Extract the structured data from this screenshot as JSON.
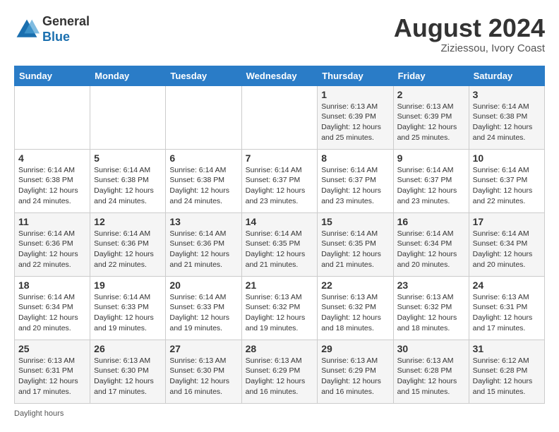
{
  "header": {
    "logo_general": "General",
    "logo_blue": "Blue",
    "title": "August 2024",
    "location": "Ziziessou, Ivory Coast"
  },
  "weekdays": [
    "Sunday",
    "Monday",
    "Tuesday",
    "Wednesday",
    "Thursday",
    "Friday",
    "Saturday"
  ],
  "weeks": [
    [
      {
        "day": "",
        "info": ""
      },
      {
        "day": "",
        "info": ""
      },
      {
        "day": "",
        "info": ""
      },
      {
        "day": "",
        "info": ""
      },
      {
        "day": "1",
        "info": "Sunrise: 6:13 AM\nSunset: 6:39 PM\nDaylight: 12 hours\nand 25 minutes."
      },
      {
        "day": "2",
        "info": "Sunrise: 6:13 AM\nSunset: 6:39 PM\nDaylight: 12 hours\nand 25 minutes."
      },
      {
        "day": "3",
        "info": "Sunrise: 6:14 AM\nSunset: 6:38 PM\nDaylight: 12 hours\nand 24 minutes."
      }
    ],
    [
      {
        "day": "4",
        "info": "Sunrise: 6:14 AM\nSunset: 6:38 PM\nDaylight: 12 hours\nand 24 minutes."
      },
      {
        "day": "5",
        "info": "Sunrise: 6:14 AM\nSunset: 6:38 PM\nDaylight: 12 hours\nand 24 minutes."
      },
      {
        "day": "6",
        "info": "Sunrise: 6:14 AM\nSunset: 6:38 PM\nDaylight: 12 hours\nand 24 minutes."
      },
      {
        "day": "7",
        "info": "Sunrise: 6:14 AM\nSunset: 6:37 PM\nDaylight: 12 hours\nand 23 minutes."
      },
      {
        "day": "8",
        "info": "Sunrise: 6:14 AM\nSunset: 6:37 PM\nDaylight: 12 hours\nand 23 minutes."
      },
      {
        "day": "9",
        "info": "Sunrise: 6:14 AM\nSunset: 6:37 PM\nDaylight: 12 hours\nand 23 minutes."
      },
      {
        "day": "10",
        "info": "Sunrise: 6:14 AM\nSunset: 6:37 PM\nDaylight: 12 hours\nand 22 minutes."
      }
    ],
    [
      {
        "day": "11",
        "info": "Sunrise: 6:14 AM\nSunset: 6:36 PM\nDaylight: 12 hours\nand 22 minutes."
      },
      {
        "day": "12",
        "info": "Sunrise: 6:14 AM\nSunset: 6:36 PM\nDaylight: 12 hours\nand 22 minutes."
      },
      {
        "day": "13",
        "info": "Sunrise: 6:14 AM\nSunset: 6:36 PM\nDaylight: 12 hours\nand 21 minutes."
      },
      {
        "day": "14",
        "info": "Sunrise: 6:14 AM\nSunset: 6:35 PM\nDaylight: 12 hours\nand 21 minutes."
      },
      {
        "day": "15",
        "info": "Sunrise: 6:14 AM\nSunset: 6:35 PM\nDaylight: 12 hours\nand 21 minutes."
      },
      {
        "day": "16",
        "info": "Sunrise: 6:14 AM\nSunset: 6:34 PM\nDaylight: 12 hours\nand 20 minutes."
      },
      {
        "day": "17",
        "info": "Sunrise: 6:14 AM\nSunset: 6:34 PM\nDaylight: 12 hours\nand 20 minutes."
      }
    ],
    [
      {
        "day": "18",
        "info": "Sunrise: 6:14 AM\nSunset: 6:34 PM\nDaylight: 12 hours\nand 20 minutes."
      },
      {
        "day": "19",
        "info": "Sunrise: 6:14 AM\nSunset: 6:33 PM\nDaylight: 12 hours\nand 19 minutes."
      },
      {
        "day": "20",
        "info": "Sunrise: 6:14 AM\nSunset: 6:33 PM\nDaylight: 12 hours\nand 19 minutes."
      },
      {
        "day": "21",
        "info": "Sunrise: 6:13 AM\nSunset: 6:32 PM\nDaylight: 12 hours\nand 19 minutes."
      },
      {
        "day": "22",
        "info": "Sunrise: 6:13 AM\nSunset: 6:32 PM\nDaylight: 12 hours\nand 18 minutes."
      },
      {
        "day": "23",
        "info": "Sunrise: 6:13 AM\nSunset: 6:32 PM\nDaylight: 12 hours\nand 18 minutes."
      },
      {
        "day": "24",
        "info": "Sunrise: 6:13 AM\nSunset: 6:31 PM\nDaylight: 12 hours\nand 17 minutes."
      }
    ],
    [
      {
        "day": "25",
        "info": "Sunrise: 6:13 AM\nSunset: 6:31 PM\nDaylight: 12 hours\nand 17 minutes."
      },
      {
        "day": "26",
        "info": "Sunrise: 6:13 AM\nSunset: 6:30 PM\nDaylight: 12 hours\nand 17 minutes."
      },
      {
        "day": "27",
        "info": "Sunrise: 6:13 AM\nSunset: 6:30 PM\nDaylight: 12 hours\nand 16 minutes."
      },
      {
        "day": "28",
        "info": "Sunrise: 6:13 AM\nSunset: 6:29 PM\nDaylight: 12 hours\nand 16 minutes."
      },
      {
        "day": "29",
        "info": "Sunrise: 6:13 AM\nSunset: 6:29 PM\nDaylight: 12 hours\nand 16 minutes."
      },
      {
        "day": "30",
        "info": "Sunrise: 6:13 AM\nSunset: 6:28 PM\nDaylight: 12 hours\nand 15 minutes."
      },
      {
        "day": "31",
        "info": "Sunrise: 6:12 AM\nSunset: 6:28 PM\nDaylight: 12 hours\nand 15 minutes."
      }
    ]
  ],
  "note": "Daylight hours"
}
